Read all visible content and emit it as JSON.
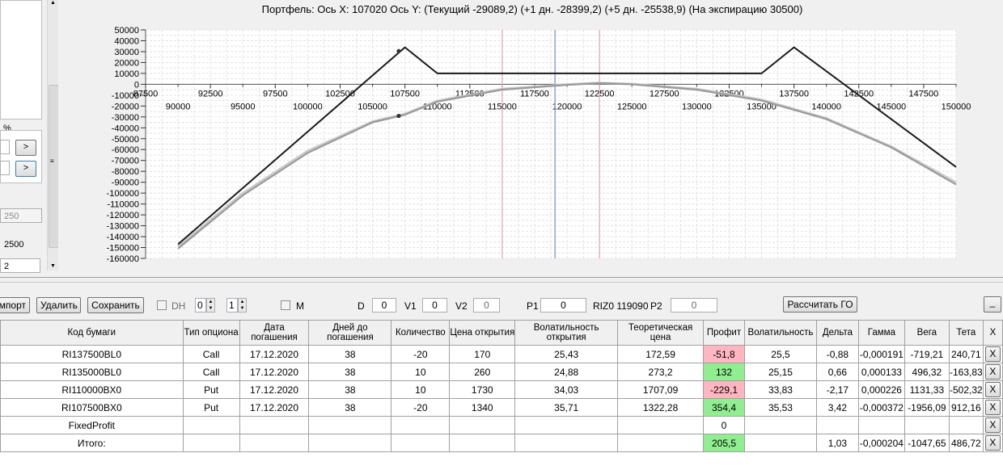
{
  "chart": {
    "header": "Портфель: Ось X: 107020 Ось Y:  (Текущий -29089,2)  (+1 дн. -28399,2)  (+5 дн. -25538,9)  (На экспирацию 30500)",
    "y_ticks": [
      "50000",
      "40000",
      "30000",
      "20000",
      "10000",
      "0",
      "-10000",
      "-20000",
      "-30000",
      "-40000",
      "-50000",
      "-60000",
      "-70000",
      "-80000",
      "-90000",
      "-100000",
      "-110000",
      "-120000",
      "-130000",
      "-140000",
      "-150000",
      "-160000"
    ],
    "x_ticks_upper": [
      "87500",
      "92500",
      "97500",
      "102500",
      "107500",
      "112500",
      "117500",
      "122500",
      "127500",
      "132500",
      "137500",
      "142500",
      "147500"
    ],
    "x_ticks_lower": [
      "90000",
      "95000",
      "100000",
      "105000",
      "110000",
      "115000",
      "120000",
      "125000",
      "130000",
      "135000",
      "140000",
      "145000",
      "150000"
    ]
  },
  "chart_data": {
    "type": "line",
    "xlim": [
      87500,
      150000
    ],
    "ylim": [
      -160000,
      50000
    ],
    "grid": true,
    "vertical_markers": [
      {
        "x": 115000,
        "color": "#e8a0b0"
      },
      {
        "x": 119070,
        "color": "#7090c0"
      },
      {
        "x": 122500,
        "color": "#e8a0b0"
      }
    ],
    "series": [
      {
        "color": "#1a1a1a",
        "points": [
          [
            90000,
            -147000
          ],
          [
            107500,
            34000
          ],
          [
            110000,
            10000
          ],
          [
            135000,
            10000
          ],
          [
            137500,
            34000
          ],
          [
            150000,
            -76000
          ]
        ]
      },
      {
        "color": "#9a9a9a",
        "points": [
          [
            90000,
            -151000
          ],
          [
            95000,
            -102000
          ],
          [
            100000,
            -63000
          ],
          [
            105000,
            -35000
          ],
          [
            107500,
            -28000
          ],
          [
            110000,
            -16000
          ],
          [
            115000,
            -5000
          ],
          [
            120000,
            -500
          ],
          [
            122500,
            1000
          ],
          [
            125000,
            0
          ],
          [
            130000,
            -5000
          ],
          [
            135000,
            -15000
          ],
          [
            140000,
            -32000
          ],
          [
            145000,
            -58000
          ],
          [
            150000,
            -92000
          ]
        ]
      },
      {
        "color": "#c8c8c8",
        "points": [
          [
            90000,
            -149000
          ],
          [
            95000,
            -100000
          ],
          [
            100000,
            -61000
          ],
          [
            105000,
            -34000
          ],
          [
            107500,
            -27000
          ],
          [
            110000,
            -15000
          ],
          [
            115000,
            -4000
          ],
          [
            120000,
            0
          ],
          [
            122500,
            1500
          ],
          [
            125000,
            500
          ],
          [
            130000,
            -4000
          ],
          [
            135000,
            -14000
          ],
          [
            140000,
            -31000
          ],
          [
            145000,
            -57000
          ],
          [
            150000,
            -90000
          ]
        ]
      }
    ],
    "markers": [
      [
        107020,
        30500
      ],
      [
        107020,
        -29089
      ]
    ]
  },
  "left_panel": {
    "percent_label": "%",
    "arrow1": ">",
    "arrow2": ">",
    "field_250": "250",
    "field_2500": "2500",
    "field_2": "2"
  },
  "toolbar": {
    "import": "Импорт",
    "delete": "Удалить",
    "save": "Сохранить",
    "dh": "DH",
    "spin1": "0",
    "spin2": "1",
    "m": "M",
    "d_label": "D",
    "d_val": "0",
    "v1_label": "V1",
    "v1_val": "0",
    "v2_label": "V2",
    "v2_val": "0",
    "p1_label": "P1",
    "p1_val": "0",
    "riz": "RIZ0 119090",
    "p2_label": "P2",
    "p2_val": "0",
    "calc_go": "Рассчитать ГО",
    "minimize": "_"
  },
  "table": {
    "headers": [
      "Код бумаги",
      "Тип опциона",
      "Дата погашения",
      "Дней до погашения",
      "Количество",
      "Цена открытия",
      "Волатильность открытия",
      "Теоретическая цена",
      "Профит",
      "Волатильность",
      "Дельта",
      "Гамма",
      "Вега",
      "Тета",
      "X"
    ],
    "rows": [
      [
        "RI137500BL0",
        "Call",
        "17.12.2020",
        "38",
        "-20",
        "170",
        "25,43",
        "172,59",
        "-51,8",
        "25,5",
        "-0,88",
        "-0,000191",
        "-719,21",
        "240,71",
        "X"
      ],
      [
        "RI135000BL0",
        "Call",
        "17.12.2020",
        "38",
        "10",
        "260",
        "24,88",
        "273,2",
        "132",
        "25,15",
        "0,66",
        "0,000133",
        "496,32",
        "-163,83",
        "X"
      ],
      [
        "RI110000BX0",
        "Put",
        "17.12.2020",
        "38",
        "10",
        "1730",
        "34,03",
        "1707,09",
        "-229,1",
        "33,83",
        "-2,17",
        "0,000226",
        "1131,33",
        "-502,32",
        "X"
      ],
      [
        "RI107500BX0",
        "Put",
        "17.12.2020",
        "38",
        "-20",
        "1340",
        "35,71",
        "1322,28",
        "354,4",
        "35,53",
        "3,42",
        "-0,000372",
        "-1956,09",
        "912,16",
        "X"
      ],
      [
        "FixedProfit",
        "",
        "",
        "",
        "",
        "",
        "",
        "",
        "0",
        "",
        "",
        "",
        "",
        "",
        "X"
      ],
      [
        "Итого:",
        "",
        "",
        "",
        "",
        "",
        "",
        "",
        "205,5",
        "",
        "1,03",
        "-0,000204",
        "-1047,65",
        "486,72",
        "X"
      ]
    ],
    "profit_status": [
      "neg",
      "pos",
      "neg",
      "pos",
      "none",
      "pos"
    ]
  }
}
